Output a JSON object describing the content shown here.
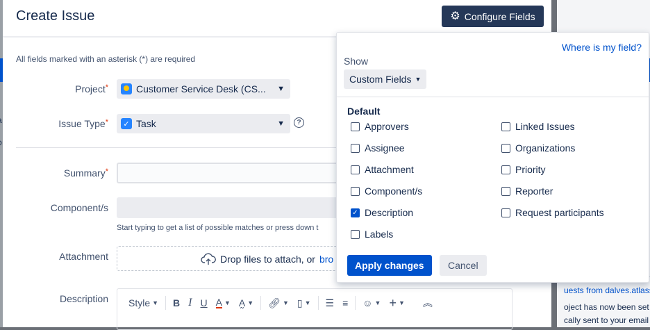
{
  "modal": {
    "title": "Create Issue",
    "configure_label": "Configure Fields",
    "required_note": "All fields marked with an asterisk (*) are required",
    "project": {
      "label": "Project",
      "value": "Customer Service Desk (CS..."
    },
    "issue_type": {
      "label": "Issue Type",
      "value": "Task"
    },
    "summary": {
      "label": "Summary"
    },
    "components": {
      "label": "Component/s",
      "hint": "Start typing to get a list of possible matches or press down t"
    },
    "attachment": {
      "label": "Attachment",
      "drop_text": "Drop files to attach, or",
      "browse": "bro"
    },
    "description": {
      "label": "Description",
      "style_label": "Style"
    },
    "asterisk": "*"
  },
  "popup": {
    "where_link": "Where is my field?",
    "show_label": "Show",
    "show_value": "Custom Fields",
    "section_title": "Default",
    "left_fields": [
      {
        "label": "Approvers",
        "checked": false
      },
      {
        "label": "Assignee",
        "checked": false
      },
      {
        "label": "Attachment",
        "checked": false
      },
      {
        "label": "Component/s",
        "checked": false
      },
      {
        "label": "Description",
        "checked": true
      },
      {
        "label": "Labels",
        "checked": false
      }
    ],
    "right_fields": [
      {
        "label": "Linked Issues",
        "checked": false
      },
      {
        "label": "Organizations",
        "checked": false
      },
      {
        "label": "Priority",
        "checked": false
      },
      {
        "label": "Reporter",
        "checked": false
      },
      {
        "label": "Request participants",
        "checked": false
      }
    ],
    "apply_label": "Apply changes",
    "cancel_label": "Cancel"
  },
  "background": {
    "line1": "uests from dalves.atlassia",
    "line2": "oject has now been set up",
    "line3": "cally sent to your email ad",
    "left_chars": [
      "a",
      "o"
    ]
  },
  "colors": {
    "primary": "#0052cc",
    "dark_button": "#253858",
    "required": "#de350b"
  }
}
